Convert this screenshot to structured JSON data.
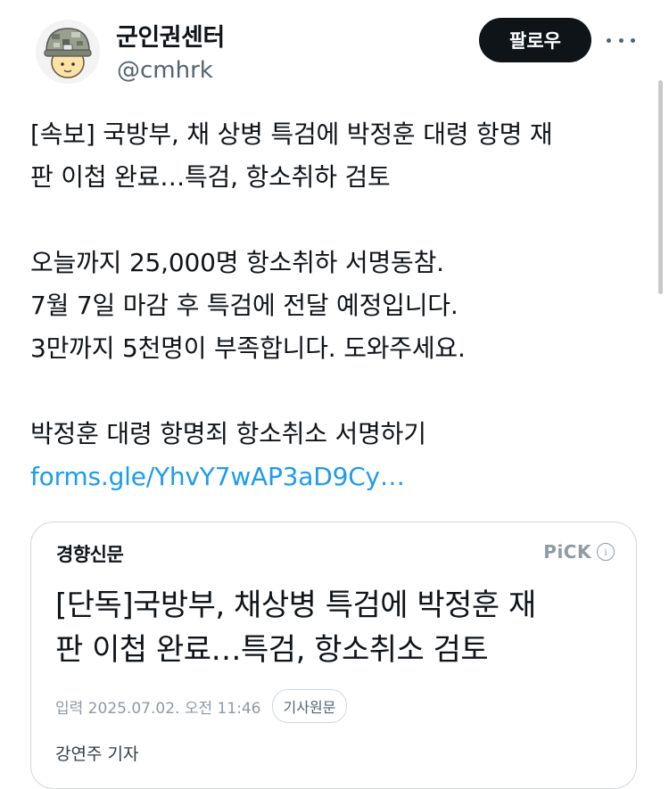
{
  "author": {
    "display_name": "군인권센터",
    "handle": "@cmhrk",
    "avatar_icon": "soldier-helmet-avatar"
  },
  "actions": {
    "follow_label": "팔로우",
    "more_icon": "more-options-icon"
  },
  "tweet": {
    "lines": [
      "[속보] 국방부, 채 상병 특검에 박정훈 대령 항명 재",
      "판 이첩 완료…특검, 항소취하 검토",
      "",
      "오늘까지 25,000명 항소취하 서명동참.",
      "7월 7일 마감 후 특검에 전달 예정입니다.",
      "3만까지 5천명이 부족합니다. 도와주세요.",
      "",
      "박정훈 대령 항명죄 항소취소 서명하기"
    ],
    "link": "forms.gle/YhvY7wAP3aD9Cy…",
    "link_color": "#1d9bf0"
  },
  "card": {
    "publisher": "경향신문",
    "pick_label": "PiCK",
    "info_symbol": "i",
    "headline_lines": [
      "[단독]국방부, 채상병 특검에 박정훈 재",
      "판 이첩 완료…특검, 항소취소 검토"
    ],
    "date": "입력 2025.07.02. 오전 11:46",
    "original_button": "기사원문",
    "reporter": "강연주 기자"
  }
}
